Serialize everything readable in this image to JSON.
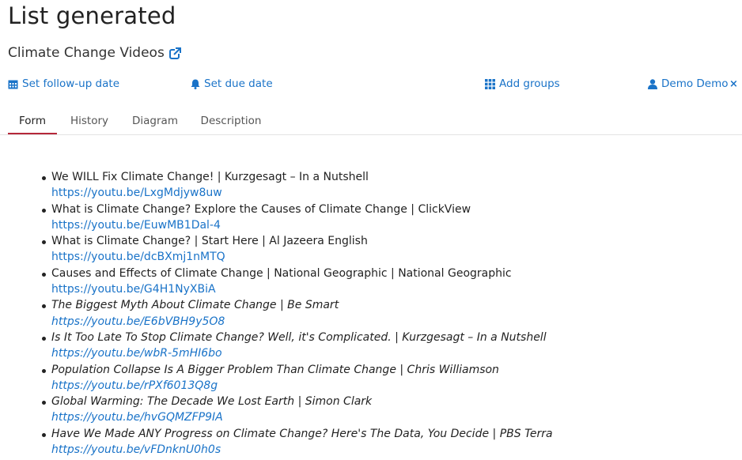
{
  "page": {
    "title": "List generated",
    "subtitle": "Climate Change Videos"
  },
  "actions": {
    "followup": "Set follow-up date",
    "due": "Set due date",
    "groups": "Add groups",
    "user": "Demo Demo",
    "close": "×"
  },
  "tabs": [
    "Form",
    "History",
    "Diagram",
    "Description"
  ],
  "videos": [
    {
      "title": "We WILL Fix Climate Change! | Kurzgesagt – In a Nutshell",
      "link": "https://youtu.be/LxgMdjyw8uw",
      "italic": false
    },
    {
      "title": "What is Climate Change? Explore the Causes of Climate Change | ClickView",
      "link": "https://youtu.be/EuwMB1Dal-4",
      "italic": false
    },
    {
      "title": "What is Climate Change? | Start Here | Al Jazeera English",
      "link": "https://youtu.be/dcBXmj1nMTQ",
      "italic": false
    },
    {
      "title": "Causes and Effects of Climate Change | National Geographic | National Geographic",
      "link": "https://youtu.be/G4H1NyXBiA",
      "italic": false
    },
    {
      "title": "The Biggest Myth About Climate Change | Be Smart",
      "link": "https://youtu.be/E6bVBH9y5O8",
      "italic": true
    },
    {
      "title": "Is It Too Late To Stop Climate Change? Well, it's Complicated. | Kurzgesagt – In a Nutshell",
      "link": "https://youtu.be/wbR-5mHI6bo",
      "italic": true
    },
    {
      "title": "Population Collapse Is A Bigger Problem Than Climate Change | Chris Williamson",
      "link": "https://youtu.be/rPXf6013Q8g",
      "italic": true
    },
    {
      "title": "Global Warming: The Decade We Lost Earth | Simon Clark",
      "link": "https://youtu.be/hvGQMZFP9IA",
      "italic": true
    },
    {
      "title": "Have We Made ANY Progress on Climate Change? Here's The Data, You Decide | PBS Terra",
      "link": "https://youtu.be/vFDnknU0h0s",
      "italic": true
    }
  ],
  "icons": {
    "external": "external-link-icon",
    "calendar": "calendar-icon",
    "bell": "bell-icon",
    "grid": "grid-icon",
    "user": "user-icon"
  },
  "colors": {
    "link": "#1a73c8",
    "activeTab": "#b5283a"
  }
}
